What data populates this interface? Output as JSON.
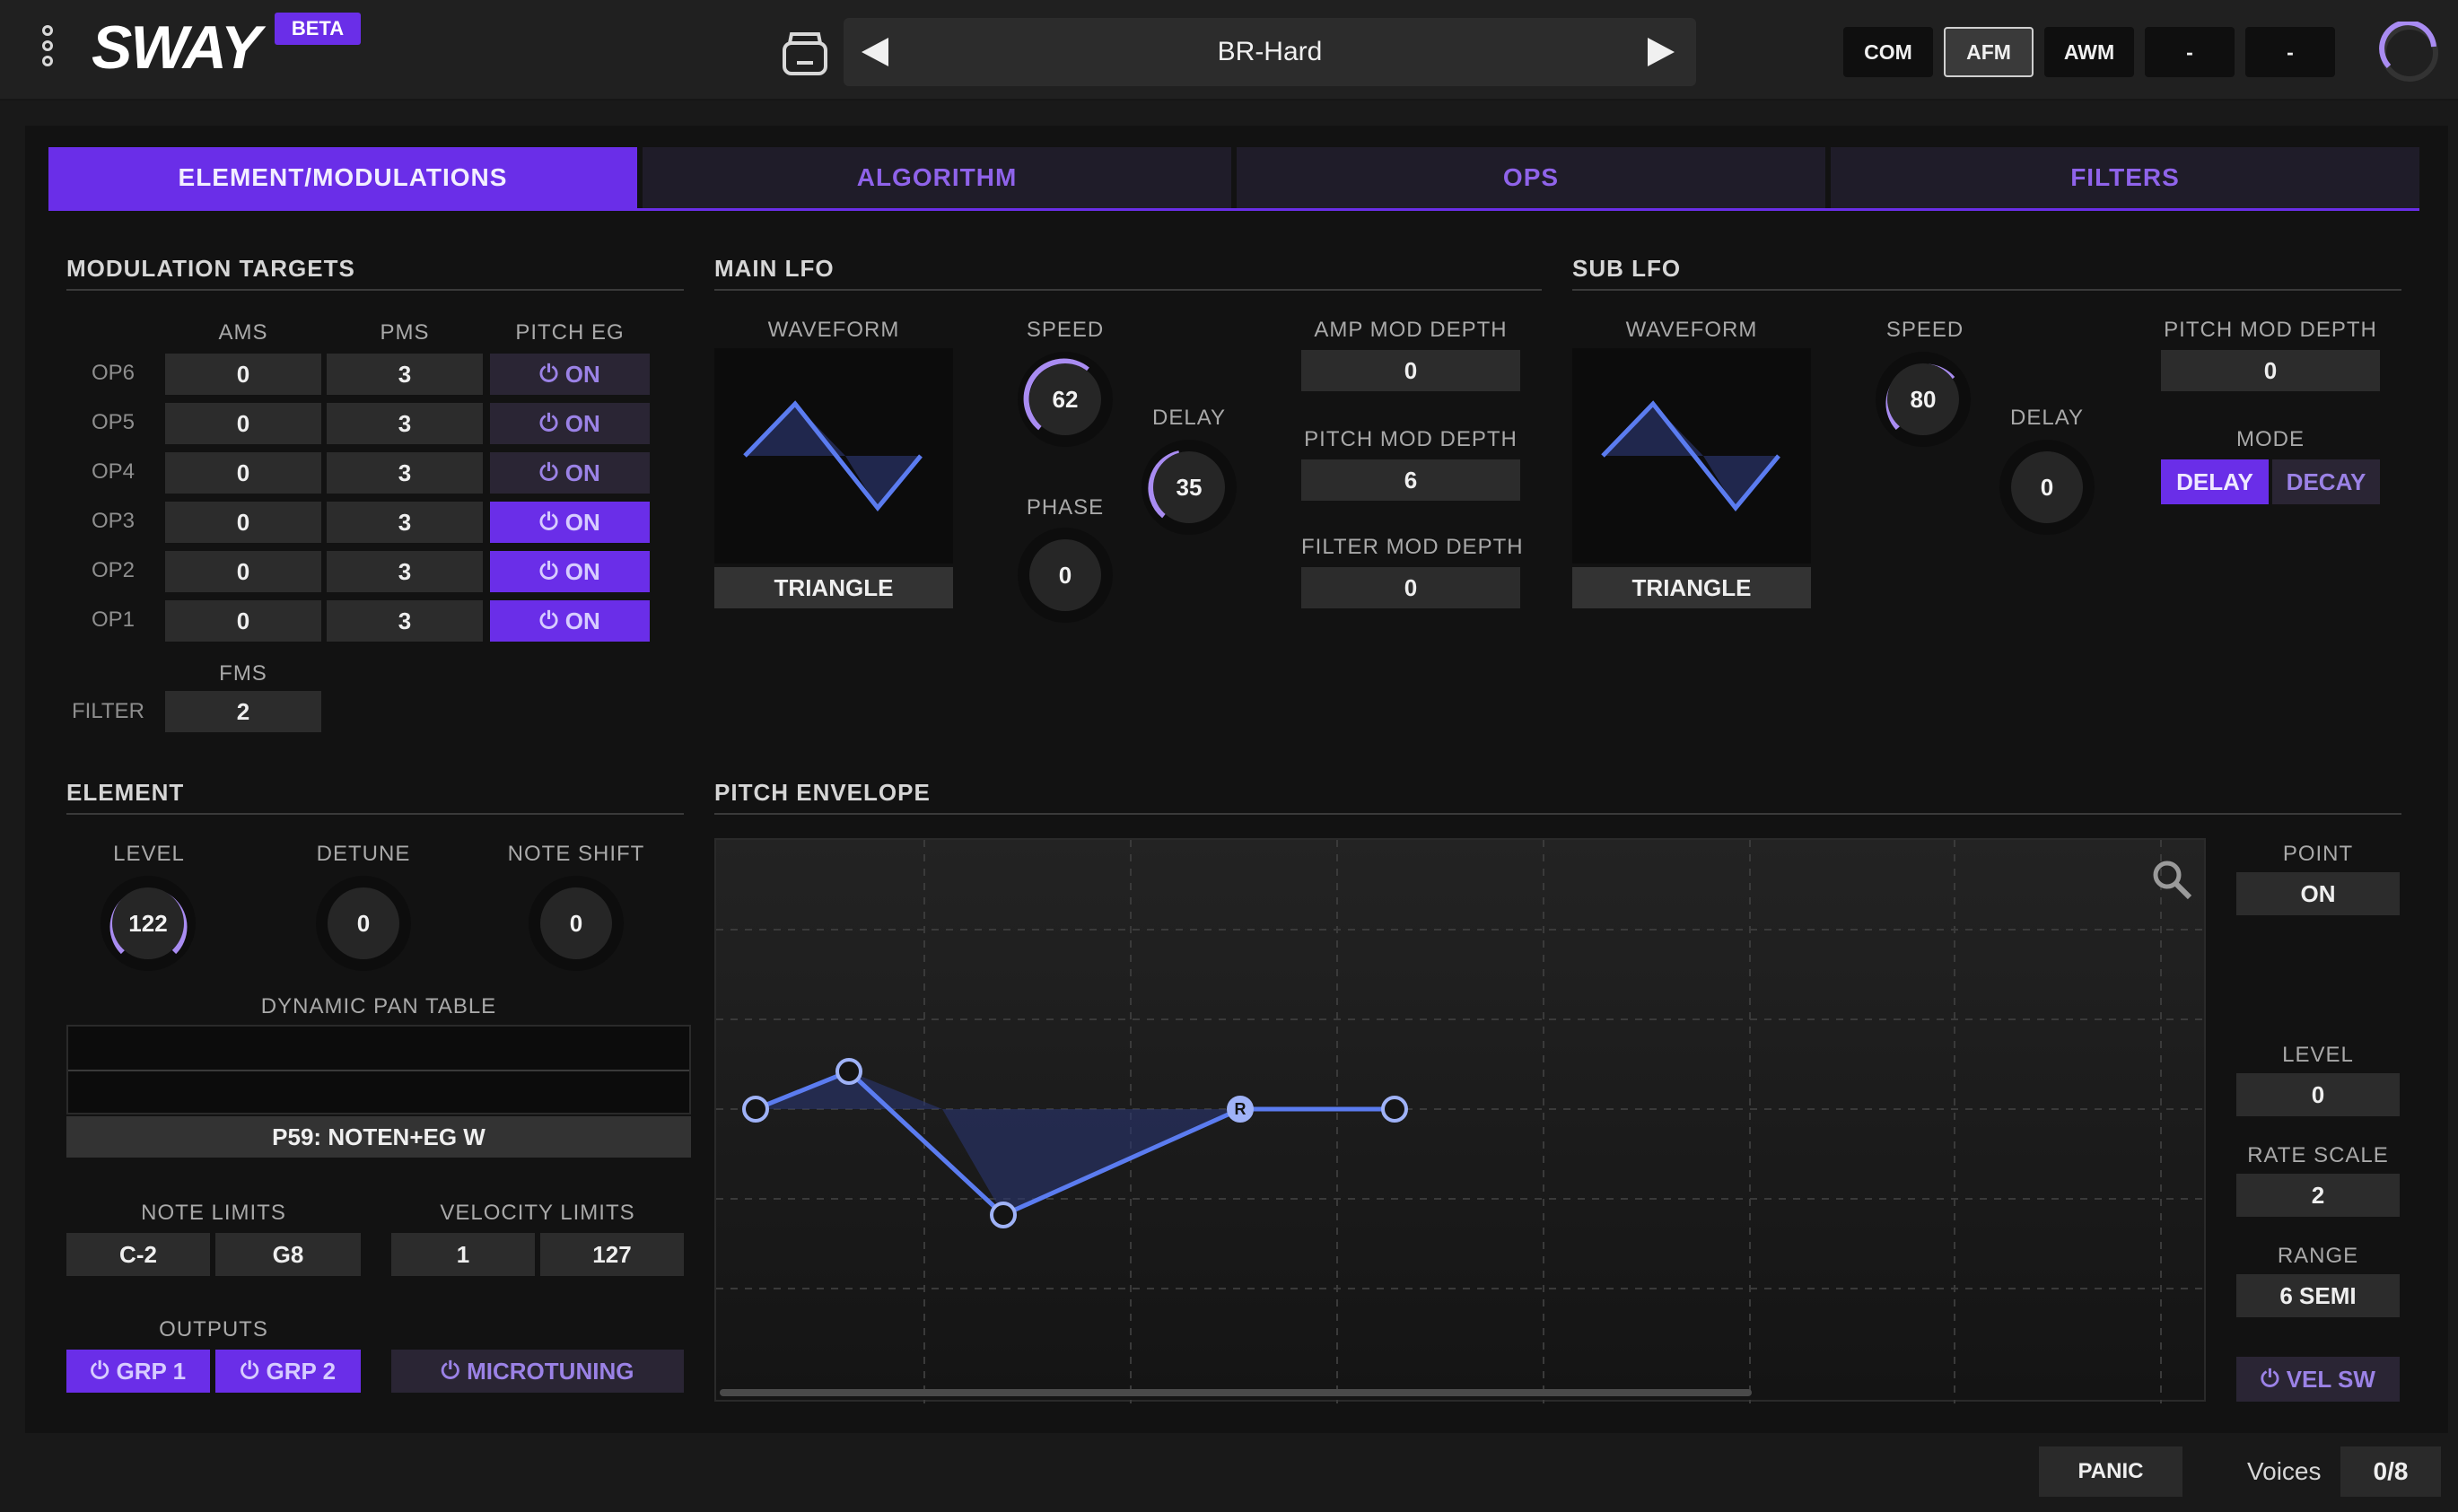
{
  "app": {
    "logo": "SWAY",
    "badge": "BETA",
    "preset_name": "BR-Hard"
  },
  "modes": [
    "COM",
    "AFM",
    "AWM",
    "-",
    "-"
  ],
  "active_mode": "AFM",
  "tabs": [
    "ELEMENT/MODULATIONS",
    "ALGORITHM",
    "OPS",
    "FILTERS"
  ],
  "modulation_targets": {
    "title": "MODULATION TARGETS",
    "headers": [
      "AMS",
      "PMS",
      "PITCH EG"
    ],
    "rows": [
      {
        "op": "OP6",
        "ams": "0",
        "pms": "3",
        "eg": "ON",
        "eg_on": false
      },
      {
        "op": "OP5",
        "ams": "0",
        "pms": "3",
        "eg": "ON",
        "eg_on": false
      },
      {
        "op": "OP4",
        "ams": "0",
        "pms": "3",
        "eg": "ON",
        "eg_on": false
      },
      {
        "op": "OP3",
        "ams": "0",
        "pms": "3",
        "eg": "ON",
        "eg_on": true
      },
      {
        "op": "OP2",
        "ams": "0",
        "pms": "3",
        "eg": "ON",
        "eg_on": true
      },
      {
        "op": "OP1",
        "ams": "0",
        "pms": "3",
        "eg": "ON",
        "eg_on": true
      }
    ],
    "fms_label": "FMS",
    "filter_label": "FILTER",
    "filter_value": "2"
  },
  "main_lfo": {
    "title": "MAIN LFO",
    "waveform_label": "WAVEFORM",
    "waveform": "TRIANGLE",
    "speed_label": "SPEED",
    "speed": "62",
    "delay_label": "DELAY",
    "delay": "35",
    "phase_label": "PHASE",
    "phase": "0",
    "amp_mod_label": "AMP MOD DEPTH",
    "amp_mod": "0",
    "pitch_mod_label": "PITCH MOD DEPTH",
    "pitch_mod": "6",
    "filter_mod_label": "FILTER MOD DEPTH",
    "filter_mod": "0"
  },
  "sub_lfo": {
    "title": "SUB LFO",
    "waveform_label": "WAVEFORM",
    "waveform": "TRIANGLE",
    "speed_label": "SPEED",
    "speed": "80",
    "delay_label": "DELAY",
    "delay": "0",
    "pitch_mod_label": "PITCH MOD DEPTH",
    "pitch_mod": "0",
    "mode_label": "MODE",
    "mode_delay": "DELAY",
    "mode_decay": "DECAY"
  },
  "element": {
    "title": "ELEMENT",
    "level_label": "LEVEL",
    "level": "122",
    "detune_label": "DETUNE",
    "detune": "0",
    "note_shift_label": "NOTE SHIFT",
    "note_shift": "0",
    "dynamic_pan_label": "DYNAMIC PAN TABLE",
    "dynamic_pan": "P59: NOTEN+EG W",
    "note_limits_label": "NOTE LIMITS",
    "note_low": "C-2",
    "note_high": "G8",
    "velocity_limits_label": "VELOCITY LIMITS",
    "vel_low": "1",
    "vel_high": "127",
    "outputs_label": "OUTPUTS",
    "grp1": "GRP 1",
    "grp2": "GRP 2",
    "microtuning": "MICROTUNING"
  },
  "pitch_envelope": {
    "title": "PITCH ENVELOPE",
    "release_marker": "R",
    "point_label": "POINT",
    "point": "ON",
    "level_label": "LEVEL",
    "level": "0",
    "rate_scale_label": "RATE SCALE",
    "rate_scale": "2",
    "range_label": "RANGE",
    "range": "6 SEMI",
    "vel_sw": "VEL SW"
  },
  "footer": {
    "panic": "PANIC",
    "voices_label": "Voices",
    "voices": "0/8"
  },
  "colors": {
    "accent": "#6a2ee8",
    "accent_text": "#8f63ea",
    "wave": "#5b7cf0",
    "knob_arc": "#a98cf2"
  },
  "icons": [
    "menu-dots-icon",
    "folder-icon",
    "prev-arrow-icon",
    "next-arrow-icon",
    "power-icon",
    "search-icon",
    "cpu-meter-icon"
  ]
}
